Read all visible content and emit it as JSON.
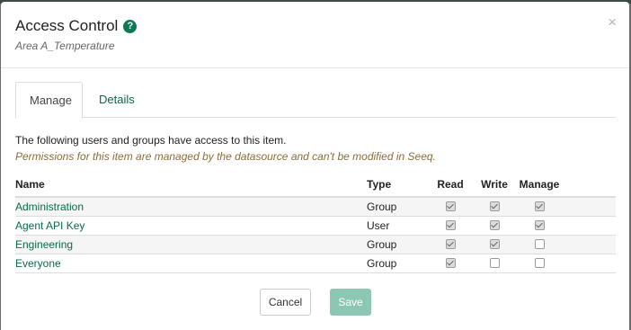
{
  "dialog": {
    "title": "Access Control",
    "help_glyph": "?",
    "subtitle": "Area A_Temperature",
    "close_glyph": "×"
  },
  "tabs": [
    {
      "label": "Manage",
      "active": true
    },
    {
      "label": "Details",
      "active": false
    }
  ],
  "description": "The following users and groups have access to this item.",
  "note": "Permissions for this item are managed by the datasource and can't be modified in Seeq.",
  "table": {
    "headers": {
      "name": "Name",
      "type": "Type",
      "read": "Read",
      "write": "Write",
      "manage": "Manage"
    },
    "rows": [
      {
        "name": "Administration",
        "type": "Group",
        "read": true,
        "write": true,
        "manage": true
      },
      {
        "name": "Agent API Key",
        "type": "User",
        "read": true,
        "write": true,
        "manage": true
      },
      {
        "name": "Engineering",
        "type": "Group",
        "read": true,
        "write": true,
        "manage": false
      },
      {
        "name": "Everyone",
        "type": "Group",
        "read": true,
        "write": false,
        "manage": false
      }
    ]
  },
  "buttons": {
    "cancel": "Cancel",
    "save": "Save"
  },
  "colors": {
    "accent": "#0a6a4c",
    "help_icon": "#0a7a57",
    "note": "#8a6d3b",
    "save_disabled": "#8cc7b3"
  }
}
